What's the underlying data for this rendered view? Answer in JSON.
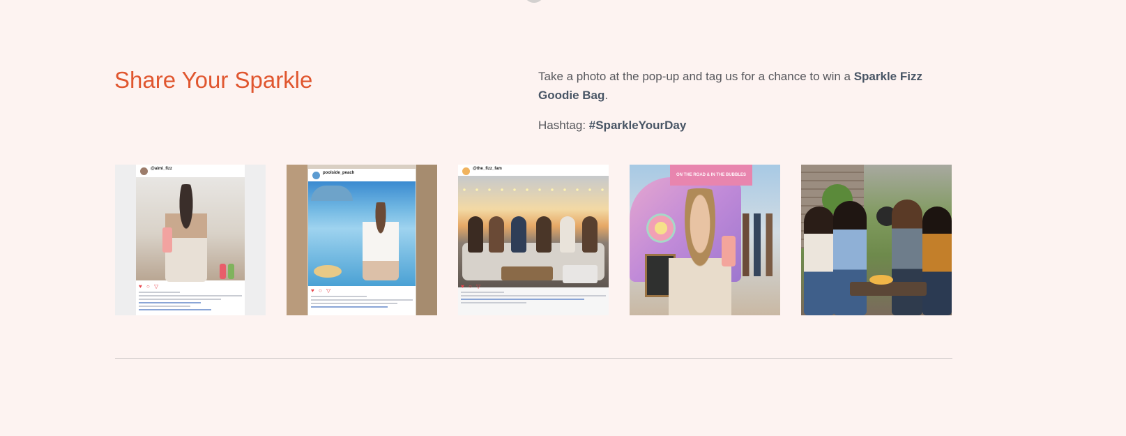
{
  "section": {
    "title": "Share Your Sparkle",
    "description_prefix": "Take a photo at the pop-up and tag us for a chance to win a ",
    "prize": "Sparkle Fizz Goodie Bag",
    "description_suffix": ".",
    "hashtag_label": "Hashtag: ",
    "hashtag": "#SparkleYourDay"
  },
  "gallery": {
    "items": [
      {
        "name": "gallery-photo-1",
        "username": "@aimi_fizz"
      },
      {
        "name": "gallery-photo-2",
        "username": "poolside_peach"
      },
      {
        "name": "gallery-photo-3",
        "username": "@the_fizz_fam"
      },
      {
        "name": "gallery-photo-4",
        "banner": "ON THE ROAD & IN THE BUBBLES"
      },
      {
        "name": "gallery-photo-5"
      }
    ]
  },
  "colors": {
    "background": "#fdf3f1",
    "accent": "#e0562f",
    "body_text": "#55565b",
    "divider": "#c9c4c3"
  }
}
